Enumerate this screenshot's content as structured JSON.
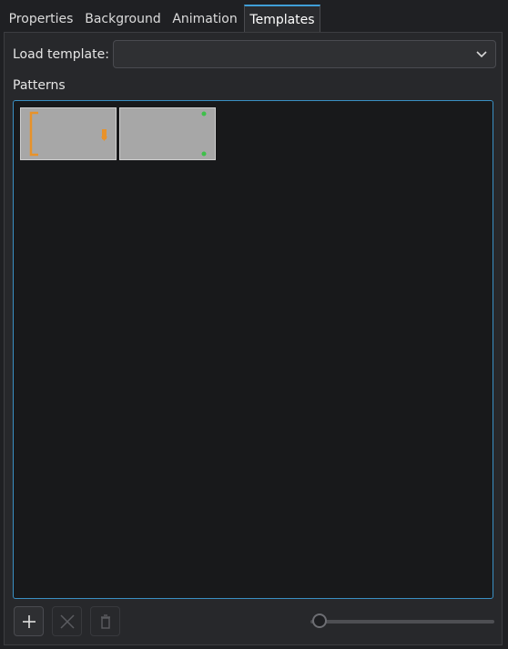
{
  "tabs": [
    {
      "label": "Properties",
      "active": false
    },
    {
      "label": "Background",
      "active": false
    },
    {
      "label": "Animation",
      "active": false
    },
    {
      "label": "Templates",
      "active": true
    }
  ],
  "template": {
    "load_label": "Load template:",
    "selected_value": "",
    "dropdown_icon": "chevron-down-icon"
  },
  "patterns": {
    "section_label": "Patterns",
    "items": [
      {
        "name": "pattern-thumbnail-1",
        "marker_color": "#e8922a"
      },
      {
        "name": "pattern-thumbnail-2",
        "marker_color": "#3ec04a"
      }
    ]
  },
  "toolbar": {
    "add_icon": "plus-icon",
    "remove_icon": "x-icon",
    "delete_icon": "trash-icon",
    "add_enabled": true,
    "remove_enabled": false,
    "delete_enabled": false
  },
  "zoom_slider": {
    "value": 0
  },
  "colors": {
    "accent": "#3f9fd8",
    "background": "#1f2023",
    "panel": "#27282b",
    "list_background": "#18191b"
  }
}
